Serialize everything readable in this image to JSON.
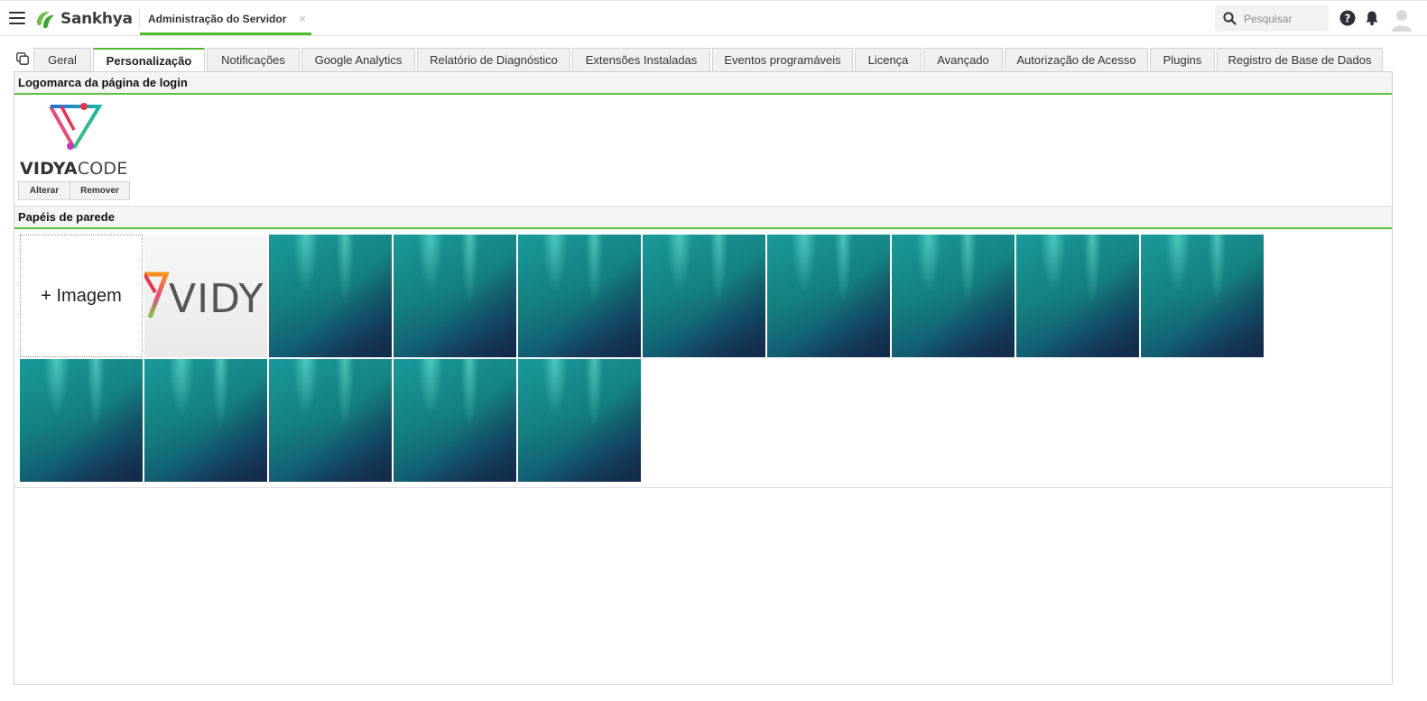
{
  "header": {
    "brand": "Sankhya",
    "app_tab_label": "Administração do Servidor",
    "close_glyph": "×",
    "search_placeholder": "Pesquisar",
    "icons": [
      "menu-icon",
      "search-icon",
      "help-icon",
      "bell-icon",
      "user-avatar-icon"
    ],
    "accent_color": "#4cbb2e"
  },
  "tabs": [
    {
      "label": "Geral"
    },
    {
      "label": "Personalização",
      "active": true
    },
    {
      "label": "Notificações"
    },
    {
      "label": "Google Analytics"
    },
    {
      "label": "Relatório de Diagnóstico"
    },
    {
      "label": "Extensões Instaladas"
    },
    {
      "label": "Eventos programáveis"
    },
    {
      "label": "Licença"
    },
    {
      "label": "Avançado"
    },
    {
      "label": "Autorização de Acesso"
    },
    {
      "label": "Plugins"
    },
    {
      "label": "Registro de Base de Dados"
    }
  ],
  "logo_section": {
    "title": "Logomarca da página de login",
    "logo_text_bold": "VIDYA",
    "logo_text_light": "CODE",
    "change_button": "Alterar",
    "remove_button": "Remover"
  },
  "wallpaper_section": {
    "title": "Papéis de parede",
    "add_label": "+ Imagem",
    "vidy_tile_text": "VIDY",
    "wallpapers": [
      {
        "kind": "vidyacode-logo"
      },
      {
        "kind": "aurora"
      },
      {
        "kind": "aurora"
      },
      {
        "kind": "aurora"
      },
      {
        "kind": "aurora"
      },
      {
        "kind": "aurora"
      },
      {
        "kind": "aurora"
      },
      {
        "kind": "aurora"
      },
      {
        "kind": "aurora"
      },
      {
        "kind": "aurora"
      },
      {
        "kind": "aurora"
      },
      {
        "kind": "aurora"
      },
      {
        "kind": "aurora"
      },
      {
        "kind": "aurora"
      }
    ]
  }
}
